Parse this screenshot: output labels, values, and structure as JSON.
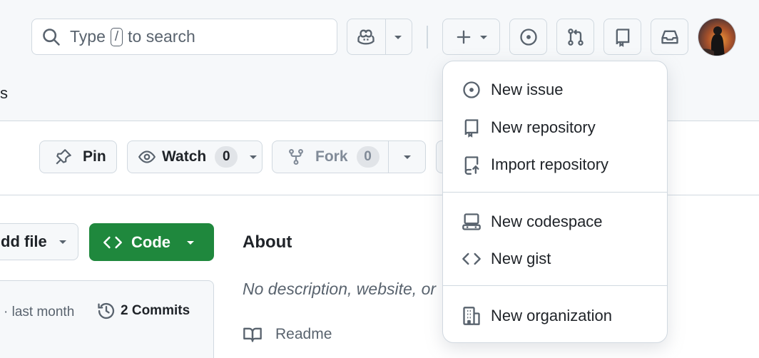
{
  "header": {
    "search": {
      "prefix": "Type",
      "key": "/",
      "suffix": "to search"
    },
    "nav_fragment": "s"
  },
  "repo_actions": {
    "pin_label": "Pin",
    "watch_label": "Watch",
    "watch_count": "0",
    "fork_label": "Fork",
    "fork_count": "0"
  },
  "files": {
    "add_file_label": "dd file",
    "code_label": "Code",
    "last_commit_time": "· last month",
    "commits_label": "2 Commits"
  },
  "about": {
    "title": "About",
    "description": "No description, website, or",
    "readme_label": "Readme"
  },
  "create_menu": {
    "items": [
      {
        "label": "New issue",
        "icon": "issue-opened-icon"
      },
      {
        "label": "New repository",
        "icon": "repo-icon"
      },
      {
        "label": "Import repository",
        "icon": "repo-push-icon"
      },
      {
        "label": "New codespace",
        "icon": "codespaces-icon"
      },
      {
        "label": "New gist",
        "icon": "code-icon"
      },
      {
        "label": "New organization",
        "icon": "organization-icon"
      }
    ]
  },
  "colors": {
    "accent_green": "#1f883d",
    "header_bg": "#f6f8fa",
    "border": "#d1d9e0",
    "muted_text": "#59636e"
  }
}
